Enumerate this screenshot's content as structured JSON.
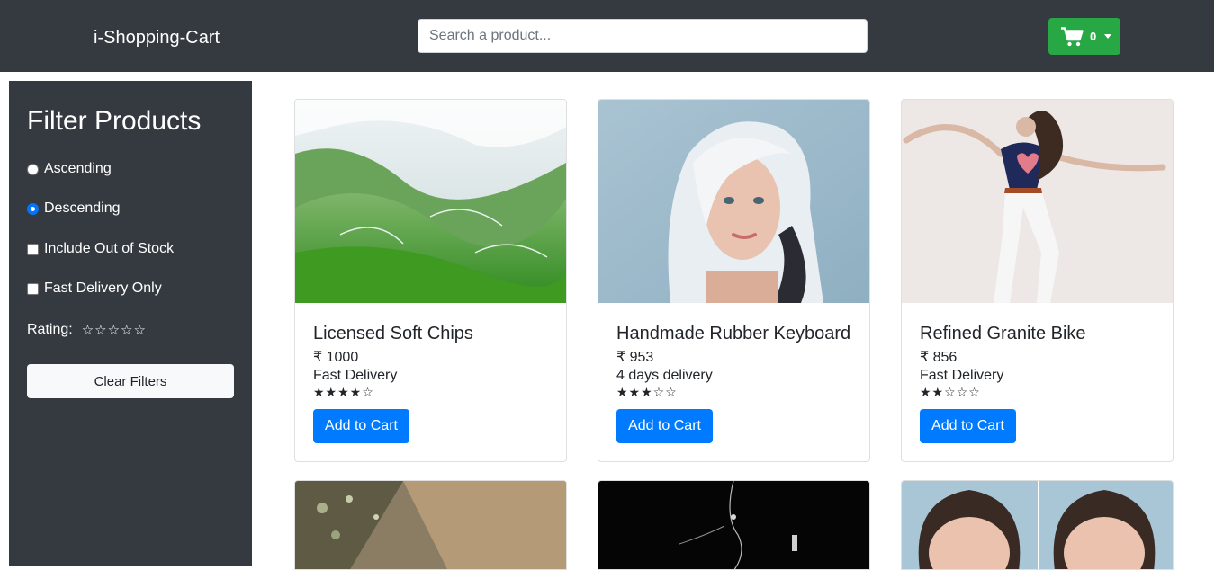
{
  "header": {
    "brand": "i-Shopping-Cart",
    "search_placeholder": "Search a product...",
    "cart_count": "0",
    "cart_icon": "shopping-cart-icon"
  },
  "sidebar": {
    "title": "Filter Products",
    "options": {
      "ascending": "Ascending",
      "descending": "Descending",
      "out_of_stock": "Include Out of Stock",
      "fast_delivery": "Fast Delivery Only"
    },
    "rating_label": "Rating:",
    "rating_stars": "☆☆☆☆☆",
    "clear_label": "Clear Filters"
  },
  "products": [
    {
      "name": "Licensed Soft Chips",
      "price": "₹ 1000",
      "delivery": "Fast Delivery",
      "stars": "★★★★☆",
      "rating": 4,
      "button": "Add to Cart"
    },
    {
      "name": "Handmade Rubber Keyboard",
      "price": "₹ 953",
      "delivery": "4 days delivery",
      "stars": "★★★☆☆",
      "rating": 3,
      "button": "Add to Cart"
    },
    {
      "name": "Refined Granite Bike",
      "price": "₹ 856",
      "delivery": "Fast Delivery",
      "stars": "★★☆☆☆",
      "rating": 2,
      "button": "Add to Cart"
    }
  ],
  "colors": {
    "header_bg": "#343a40",
    "cart_green": "#28a745",
    "button_blue": "#007bff",
    "radio_blue": "#0075ff"
  }
}
